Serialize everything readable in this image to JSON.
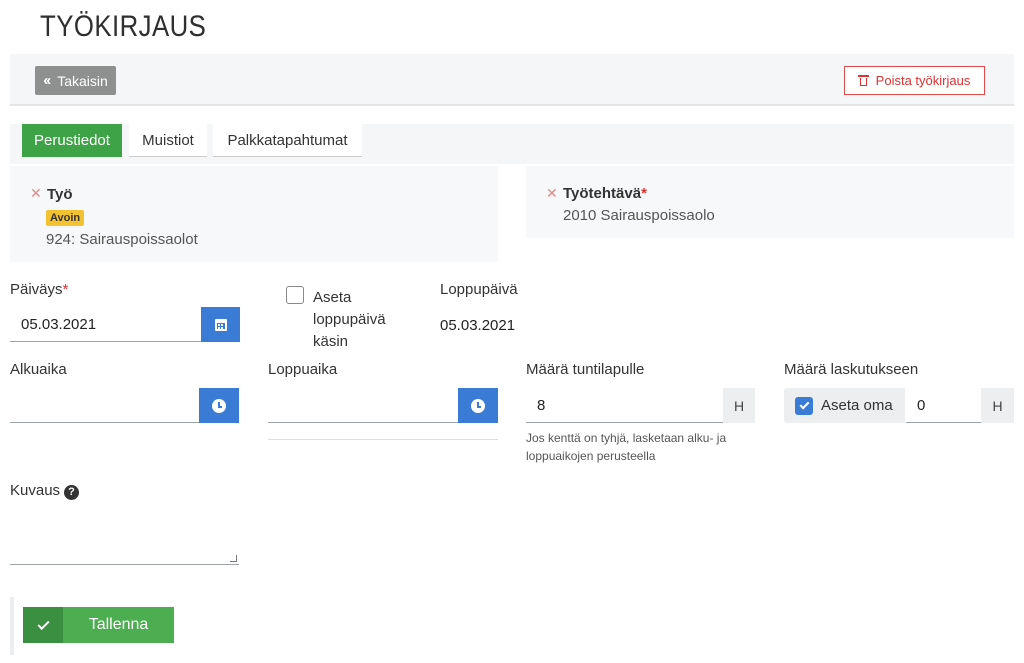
{
  "page": {
    "title": "TYÖKIRJAUS"
  },
  "toolbar": {
    "back_label": "Takaisin",
    "delete_label": "Poista työkirjaus"
  },
  "tabs": [
    {
      "label": "Perustiedot",
      "active": true
    },
    {
      "label": "Muistiot",
      "active": false
    },
    {
      "label": "Palkkatapahtumat",
      "active": false
    }
  ],
  "work": {
    "label": "Työ",
    "status_badge": "Avoin",
    "value": "924: Sairauspoissaolot"
  },
  "task": {
    "label": "Työtehtävä",
    "required_mark": "*",
    "value": "2010 Sairauspoissaolo"
  },
  "date": {
    "label": "Päiväys",
    "required_mark": "*",
    "value": "05.03.2021",
    "icon": "calendar-icon"
  },
  "manual_end": {
    "label": "Aseta loppupäivä käsin",
    "checked": false
  },
  "end_date": {
    "label": "Loppupäivä",
    "value": "05.03.2021"
  },
  "start_time": {
    "label": "Alkuaika",
    "value": "",
    "icon": "clock-icon"
  },
  "end_time": {
    "label": "Loppuaika",
    "value": "",
    "icon": "clock-icon"
  },
  "hours": {
    "label": "Määrä tuntilapulle",
    "value": "8",
    "unit": "H",
    "help": "Jos kenttä on tyhjä, lasketaan alku- ja loppuaikojen perusteella"
  },
  "billing": {
    "label": "Määrä laskutukseen",
    "override_label": "Aseta oma",
    "override_checked": true,
    "value": "0",
    "unit": "H"
  },
  "description": {
    "label": "Kuvaus",
    "help_icon": "?",
    "value": ""
  },
  "save": {
    "label": "Tallenna"
  },
  "colors": {
    "accent_green": "#3ea247",
    "accent_blue": "#3a7bd5",
    "danger": "#d33333",
    "badge": "#f2c230"
  }
}
